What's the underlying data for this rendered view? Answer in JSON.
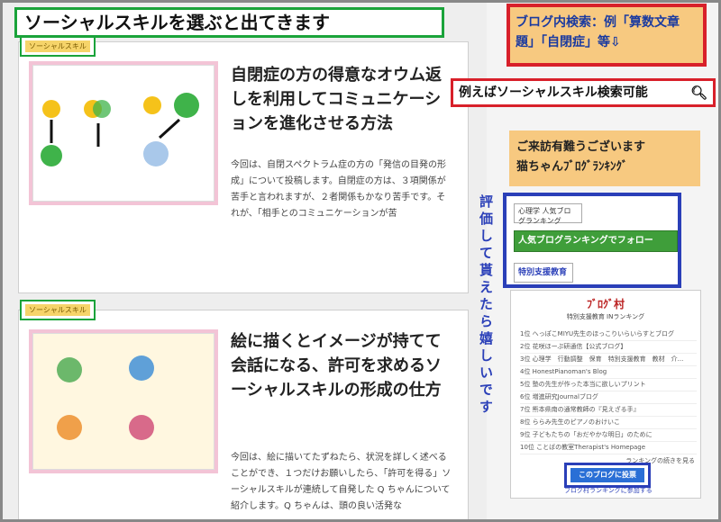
{
  "banner": {
    "text": "ソーシャルスキルを選ぶと出てきます"
  },
  "posts": [
    {
      "tag": "ソーシャルスキル",
      "title": "自閉症の方の得意なオウム返しを利用してコミュニケーションを進化させる方法",
      "excerpt": "今回は、自閉スペクトラム症の方の「発信の目発の形成」について投稿します。自閉症の方は、３項関係が苦手と言われますが、２者関係もかなり苦手です。それが、「相手とのコミュニケーションが苦"
    },
    {
      "tag": "ソーシャルスキル",
      "title": "絵に描くとイメージが持てて会話になる、許可を求めるソーシャルスキルの形成の仕方",
      "excerpt": "今回は、絵に描いてたずねたら、状況を詳しく述べることができ、１つだけお願いしたら、「許可を得る」ソーシャルスキルが連続して自発した Q ちゃんについて紹介します。Q ちゃんは、頭の良い活発な"
    }
  ],
  "sidebar": {
    "search_note": "ブログ内検索：例「算数文章題」「自閉症」等⇩",
    "search_value": "例えばソーシャルスキル検索可能",
    "thanks_line1": "ご来訪有難うございます",
    "thanks_line2": "猫ちゃんﾌﾞﾛｸﾞﾗﾝｷﾝｸﾞ",
    "vertical_note": "評価して貰えたら嬉しいです",
    "banner1": "心理学 人気ブログランキング",
    "banner2": "人気ブログランキングでフォロー",
    "banner3": "特別支援教育",
    "ranking_logo": "ﾌﾞﾛｸﾞ村",
    "ranking_sub": "特別支援教育 INランキング",
    "ranking_items": [
      "1位 へっぽこMIYU先生のほっこりいらいらすとブログ",
      "2位 花咲ほーぷ研通信【公式ブログ】",
      "3位 心理学　行動調整　保育　特別支援教育　教材　介...",
      "4位 HonestPianoman's Blog",
      "5位 塾の先生が作った本当に欲しいプリント",
      "6位 増進研究Journalブログ",
      "7位 熊本県南の通常教師の『見えざる手』",
      "8位 ららみ先生のピアノのおけいこ",
      "9位 子どもたちの「おだやかな明日」のために",
      "10位 ことばの教室Therapist's Homepage"
    ],
    "ranking_more": "ランキングの続きを見る",
    "vote_label": "このブログに投票",
    "ranking_footer": "ブログ村ランキングに参加する"
  }
}
